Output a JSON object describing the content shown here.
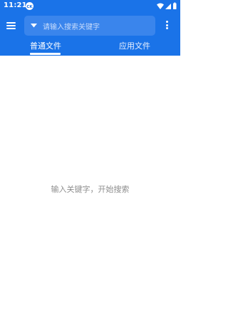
{
  "status_bar": {
    "time": "11:21",
    "notification_icon": "ck-badge-icon",
    "icons": [
      "wifi-icon",
      "signal-icon",
      "battery-icon"
    ]
  },
  "toolbar": {
    "menu_icon": "hamburger-menu-icon",
    "search_placeholder": "请输入搜索关键字",
    "more_icon": "more-vertical-icon"
  },
  "tabs": [
    {
      "label": "普通文件",
      "selected": true
    },
    {
      "label": "应用文件",
      "selected": false
    }
  ],
  "content": {
    "empty_message": "输入关键字，开始搜索"
  },
  "colors": {
    "primary": "#1a73e8",
    "search_box": "#3a85ec",
    "placeholder_text": "#c7dbfb",
    "background": "#ffffff",
    "hint_text": "#8e8e8e"
  }
}
